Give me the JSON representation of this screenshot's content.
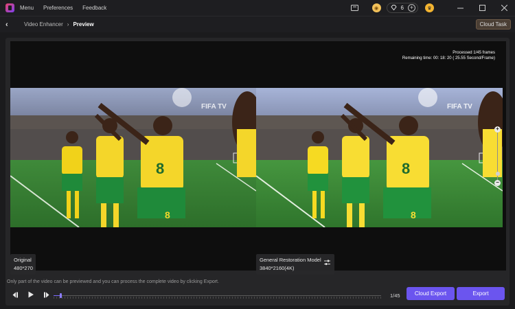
{
  "app": {
    "menu": [
      "Menu",
      "Preferences",
      "Feedback"
    ],
    "credits": "6",
    "coin_icon": "coin-icon",
    "avatar_icon": "crown-avatar-icon"
  },
  "breadcrumb": {
    "parent": "Video Enhancer",
    "current": "Preview"
  },
  "cloud_task_label": "Cloud Task",
  "preview": {
    "processed": "Processed 1/45 frames",
    "remaining": "Remaining time: 00: 18: 20 ( 25.55 Second/Frame)",
    "watermark": "FIFA TV",
    "original": {
      "label": "Original",
      "resolution": "480*270"
    },
    "enhanced": {
      "label": "General Restoration Model",
      "resolution": "3840*2160(4K)"
    }
  },
  "notice": "Only part of the video can be previewed and you can process the complete video by clicking Export.",
  "playback": {
    "frame_count": "1/45",
    "progress": 0.022,
    "cloud_export_label": "Cloud Export",
    "export_label": "Export"
  },
  "colors": {
    "accent": "#6b55ef",
    "cloud_task_bg": "#4a3e34"
  }
}
